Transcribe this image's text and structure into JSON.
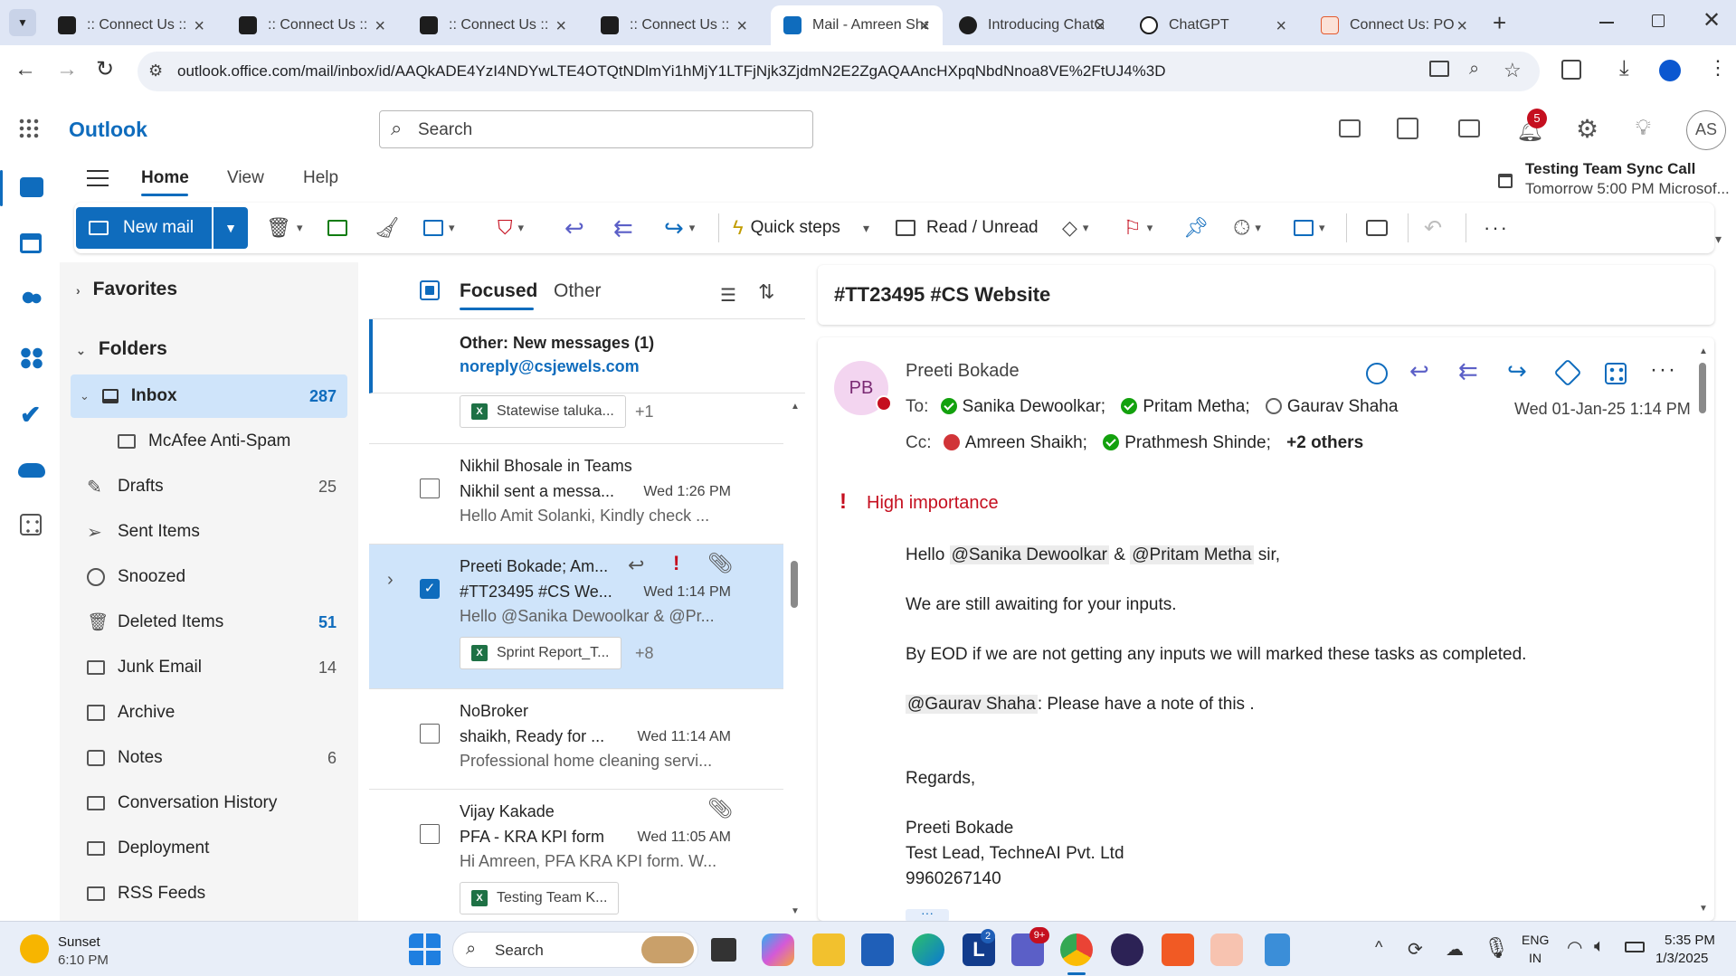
{
  "browser": {
    "tabs": [
      {
        "title": ":: Connect Us ::",
        "color": "#1d1d1d"
      },
      {
        "title": ":: Connect Us ::",
        "color": "#1d1d1d"
      },
      {
        "title": ":: Connect Us ::",
        "color": "#1d1d1d"
      },
      {
        "title": ":: Connect Us ::",
        "color": "#1d1d1d"
      },
      {
        "title": "Mail - Amreen Sha",
        "color": "#0f6cbd"
      },
      {
        "title": "Introducing ChatGPT",
        "color": "#1d1d1d"
      },
      {
        "title": "ChatGPT",
        "color": "#1d1d1d"
      },
      {
        "title": "Connect Us: PO",
        "color": "#e35a2f"
      }
    ],
    "url": "outlook.office.com/mail/inbox/id/AAQkADE4YzI4NDYwLTE4OTQtNDlmYi1hMjY1LTFjNjk3ZjdmN2E2ZgAQAAncHXpqNbdNnoa8VE%2FtUJ4%3D"
  },
  "outlook": {
    "app_name": "Outlook",
    "search_placeholder": "Search",
    "notification_count": "5",
    "avatar": "AS",
    "menu": [
      "Home",
      "View",
      "Help"
    ],
    "reminder": {
      "title": "Testing Team Sync Call",
      "subtitle": "Tomorrow 5:00 PM Microsof..."
    },
    "ribbon": {
      "new_mail": "New mail",
      "quick_steps": "Quick steps",
      "read_unread": "Read / Unread"
    }
  },
  "folders": {
    "favorites": "Favorites",
    "folders_label": "Folders",
    "items": [
      {
        "name": "Inbox",
        "count": "287"
      },
      {
        "name": "McAfee Anti-Spam",
        "count": ""
      },
      {
        "name": "Drafts",
        "count": "25"
      },
      {
        "name": "Sent Items",
        "count": ""
      },
      {
        "name": "Snoozed",
        "count": ""
      },
      {
        "name": "Deleted Items",
        "count": "51"
      },
      {
        "name": "Junk Email",
        "count": "14"
      },
      {
        "name": "Archive",
        "count": ""
      },
      {
        "name": "Notes",
        "count": "6"
      },
      {
        "name": "Conversation History",
        "count": ""
      },
      {
        "name": "Deployment",
        "count": ""
      },
      {
        "name": "RSS Feeds",
        "count": ""
      }
    ]
  },
  "list": {
    "focused": "Focused",
    "other": "Other",
    "banner": {
      "title": "Other: New messages (1)",
      "sender": "noreply@csjewels.com"
    },
    "top_attachment": {
      "name": "Statewise taluka...",
      "more": "+1"
    },
    "messages": [
      {
        "sender": "Nikhil Bhosale in Teams",
        "subject": "Nikhil sent a messa...",
        "time": "Wed 1:26 PM",
        "preview": "Hello Amit Solanki, Kindly check ..."
      },
      {
        "sender": "Preeti Bokade; Am...",
        "subject": "#TT23495 #CS We...",
        "time": "Wed 1:14 PM",
        "preview": "Hello @Sanika Dewoolkar & @Pr...",
        "attachment": "Sprint Report_T...",
        "more": "+8"
      },
      {
        "sender": "NoBroker",
        "subject": "shaikh, Ready for ...",
        "time": "Wed 11:14 AM",
        "preview": "Professional home cleaning servi..."
      },
      {
        "sender": "Vijay Kakade",
        "subject": "PFA - KRA KPI form",
        "time": "Wed 11:05 AM",
        "preview": "Hi Amreen, PFA KRA KPI form. W...",
        "attachment": "Testing Team K..."
      }
    ]
  },
  "reading": {
    "subject": "#TT23495 #CS Website",
    "from_initials": "PB",
    "from": "Preeti Bokade",
    "to_label": "To:",
    "to": [
      "Sanika Dewoolkar;",
      "Pritam Metha;",
      "Gaurav Shaha"
    ],
    "cc_label": "Cc:",
    "cc": [
      "Amreen Shaikh;",
      "Prathmesh Shinde;"
    ],
    "cc_more": "+2 others",
    "date": "Wed 01-Jan-25 1:14 PM",
    "importance": "High importance",
    "body": {
      "greeting_pre": "Hello ",
      "mention1": "@Sanika Dewoolkar",
      "amp": " & ",
      "mention2": "@Pritam Metha",
      "greeting_post": " sir,",
      "line1": "We are still awaiting for your inputs.",
      "line2": "By EOD if we are not getting any inputs we will marked these tasks as completed.",
      "mention3": "@Gaurav Shaha",
      "line3": ": Please have a note of this .",
      "regards": "Regards,",
      "sig_name": "Preeti Bokade",
      "sig_title": "Test Lead, TechneAI Pvt. Ltd",
      "sig_phone": "9960267140"
    }
  },
  "taskbar": {
    "weather_title": "Sunset",
    "weather_time": "6:10 PM",
    "search": "Search",
    "teams_badge": "9+",
    "l_badge": "2",
    "lang1": "ENG",
    "lang2": "IN",
    "time": "5:35 PM",
    "date": "1/3/2025"
  },
  "colors": {
    "accent": "#0f6cbd",
    "selected": "#cfe4fa",
    "importance": "#c50f1f"
  }
}
